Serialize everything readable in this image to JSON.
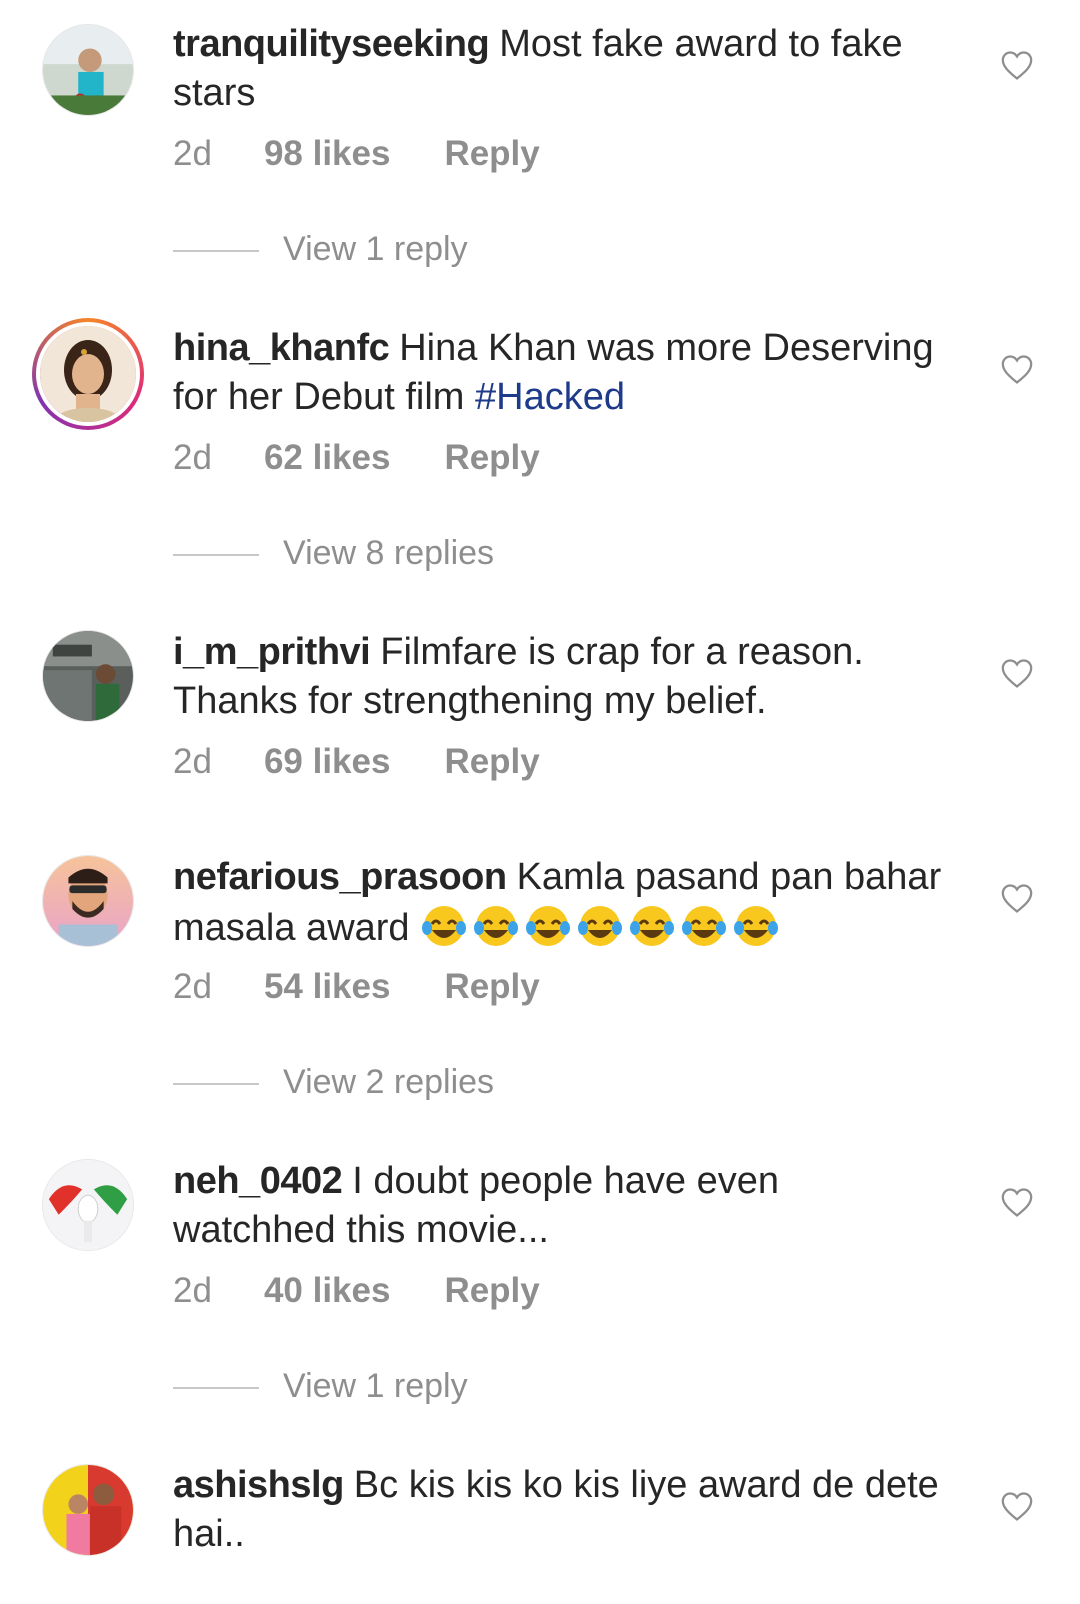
{
  "comments": [
    {
      "username": "tranquilityseeking",
      "text": "Most fake award to fake stars",
      "time": "2d",
      "likes": "98 likes",
      "reply": "Reply",
      "view_replies": "View 1 reply"
    },
    {
      "username": "hina_khanfc",
      "text": "Hina Khan was more Deserving for her Debut film",
      "hashtag": "#Hacked",
      "time": "2d",
      "likes": "62 likes",
      "reply": "Reply",
      "view_replies": "View 8 replies"
    },
    {
      "username": "i_m_prithvi",
      "text": "Filmfare is crap for a reason. Thanks for strengthening my belief.",
      "time": "2d",
      "likes": "69 likes",
      "reply": "Reply"
    },
    {
      "username": "nefarious_prasoon",
      "text": "Kamla pasand pan bahar masala award",
      "emojis": "😂😂😂😂😂😂😂",
      "time": "2d",
      "likes": "54 likes",
      "reply": "Reply",
      "view_replies": "View 2 replies"
    },
    {
      "username": "neh_0402",
      "text": "I doubt people have even watchhed this movie...",
      "time": "2d",
      "likes": "40 likes",
      "reply": "Reply",
      "view_replies": "View 1 reply"
    },
    {
      "username": "ashishslg",
      "text": "Bc kis kis ko kis liye award de dete hai..",
      "time": "",
      "likes": "",
      "reply": ""
    }
  ],
  "icons": {
    "like": "heart-outline-icon",
    "emoji": "face-with-tears-of-joy"
  },
  "colors": {
    "text": "#262626",
    "secondary": "#8e8e8e",
    "hashtag": "#1e3a8a"
  }
}
